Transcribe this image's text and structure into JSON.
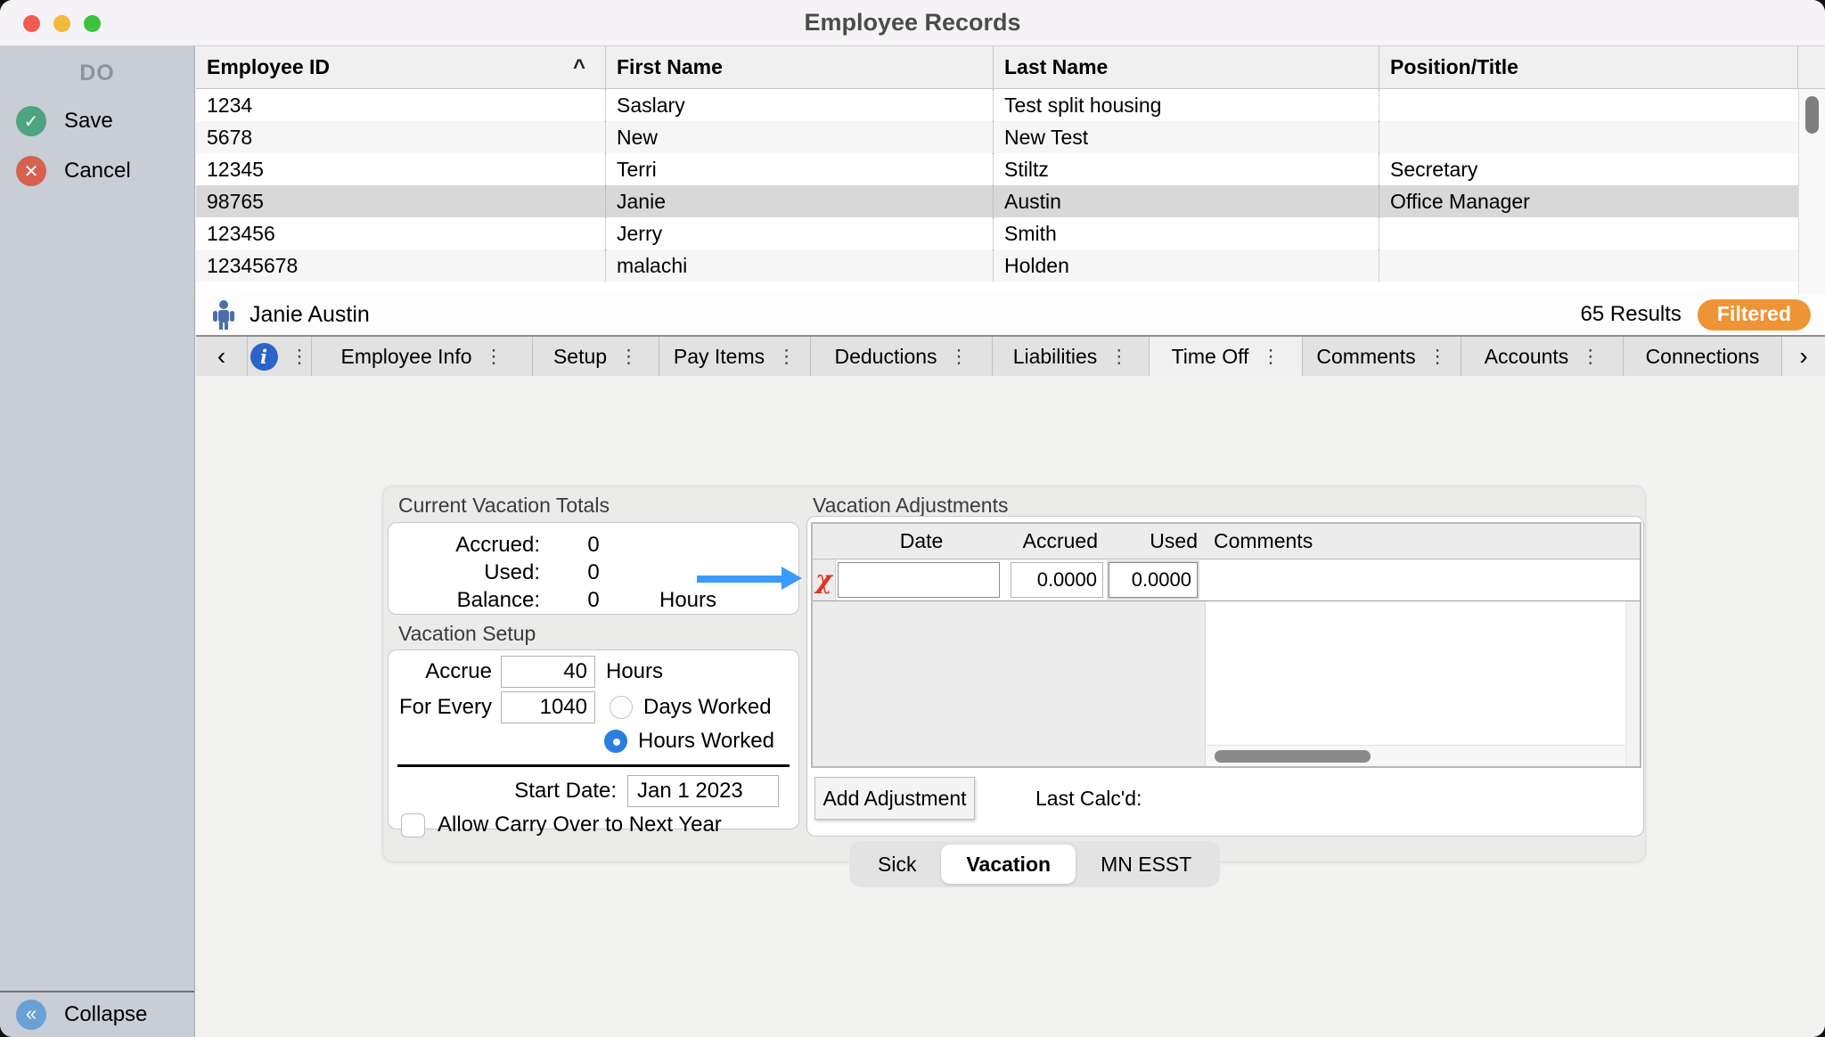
{
  "window": {
    "title": "Employee Records"
  },
  "sidebar": {
    "header": "DO",
    "save_label": "Save",
    "cancel_label": "Cancel",
    "collapse_label": "Collapse",
    "save_color": "#4da382",
    "cancel_color": "#d5614e",
    "collapse_color": "#69a1d6"
  },
  "employee_table": {
    "columns": [
      "Employee ID",
      "First Name",
      "Last Name",
      "Position/Title"
    ],
    "sort_indicator": "^",
    "rows": [
      {
        "employee_id": "1234",
        "first_name": "Saslary",
        "last_name": "Test split housing",
        "position": ""
      },
      {
        "employee_id": "5678",
        "first_name": "New",
        "last_name": "New Test",
        "position": ""
      },
      {
        "employee_id": "12345",
        "first_name": "Terri",
        "last_name": "Stiltz",
        "position": "Secretary"
      },
      {
        "employee_id": "98765",
        "first_name": "Janie",
        "last_name": "Austin",
        "position": "Office Manager"
      },
      {
        "employee_id": "123456",
        "first_name": "Jerry",
        "last_name": "Smith",
        "position": ""
      },
      {
        "employee_id": "12345678",
        "first_name": "malachi",
        "last_name": "Holden",
        "position": ""
      }
    ],
    "selected_row_index": 3
  },
  "detail_header": {
    "name": "Janie Austin",
    "results": "65 Results",
    "filter_badge": "Filtered",
    "badge_color": "#ef9434"
  },
  "tab_bar": {
    "back": "‹",
    "forward": "›",
    "info_icon": "i",
    "ellipsis": "⋮",
    "tabs": [
      {
        "label": "Employee Info"
      },
      {
        "label": "Setup"
      },
      {
        "label": "Pay Items"
      },
      {
        "label": "Deductions"
      },
      {
        "label": "Liabilities"
      },
      {
        "label": "Time Off",
        "active": true
      },
      {
        "label": "Comments"
      },
      {
        "label": "Accounts"
      },
      {
        "label": "Connections"
      }
    ]
  },
  "time_off": {
    "totals": {
      "title": "Current Vacation Totals",
      "accrued_label": "Accrued:",
      "accrued_value": "0",
      "used_label": "Used:",
      "used_value": "0",
      "balance_label": "Balance:",
      "balance_value": "0",
      "unit": "Hours"
    },
    "setup": {
      "title": "Vacation Setup",
      "accrue_label": "Accrue",
      "accrue_value": "40",
      "accrue_unit": "Hours",
      "for_every_label": "For Every",
      "for_every_value": "1040",
      "radio_days_label": "Days Worked",
      "radio_hours_label": "Hours Worked",
      "selected_radio": "Hours Worked",
      "start_date_label": "Start Date:",
      "start_date_value": "Jan 1 2023",
      "carry_over_label": "Allow Carry Over to Next Year",
      "carry_over_checked": false
    },
    "adjustments": {
      "title": "Vacation Adjustments",
      "columns": [
        "Date",
        "Accrued",
        "Used",
        "Comments"
      ],
      "row": {
        "date": "",
        "accrued": "0.0000",
        "used": "0.0000",
        "comments": ""
      },
      "add_button_label": "Add Adjustment",
      "last_calc_label": "Last Calc'd:",
      "arrow_color": "#3b9bfd"
    },
    "bottom_tabs": {
      "sick": "Sick",
      "vacation": "Vacation",
      "mn_esst": "MN ESST",
      "active": "Vacation"
    }
  }
}
